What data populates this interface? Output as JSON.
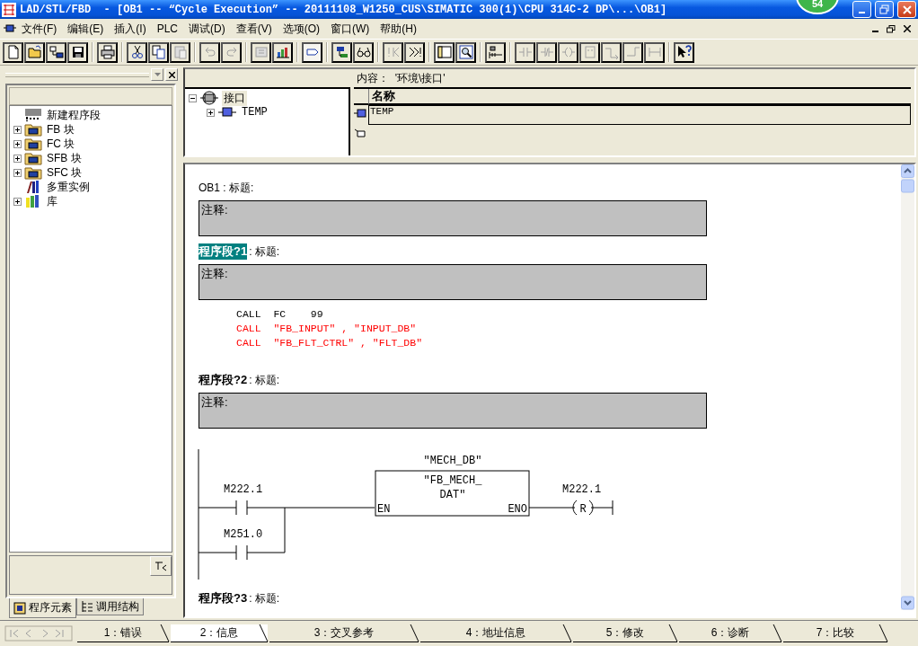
{
  "window": {
    "title": "LAD/STL/FBD  - [OB1 -- “Cycle Execution” -- 20111108_W1250_CUS\\SIMATIC 300(1)\\CPU 314C-2 DP\\...\\OB1]",
    "badge": "54"
  },
  "menu": [
    "文件(F)",
    "编辑(E)",
    "插入(I)",
    "PLC",
    "调试(D)",
    "查看(V)",
    "选项(O)",
    "窗口(W)",
    "帮助(H)"
  ],
  "toolbar": [
    {
      "kind": "new",
      "disabled": false,
      "pressed": false
    },
    {
      "kind": "open",
      "disabled": false,
      "pressed": false
    },
    {
      "kind": "network",
      "disabled": false,
      "pressed": false
    },
    {
      "kind": "save",
      "disabled": false,
      "pressed": false
    },
    {
      "kind": "separator"
    },
    {
      "kind": "print",
      "disabled": false,
      "pressed": false
    },
    {
      "kind": "separator"
    },
    {
      "kind": "cut",
      "disabled": false,
      "pressed": false
    },
    {
      "kind": "copy",
      "disabled": false,
      "pressed": false
    },
    {
      "kind": "paste",
      "disabled": true,
      "pressed": false
    },
    {
      "kind": "separator"
    },
    {
      "kind": "undo",
      "disabled": true,
      "pressed": false
    },
    {
      "kind": "redo",
      "disabled": true,
      "pressed": false
    },
    {
      "kind": "separator"
    },
    {
      "kind": "module",
      "disabled": true,
      "pressed": false
    },
    {
      "kind": "chart",
      "disabled": false,
      "pressed": false
    },
    {
      "kind": "separator"
    },
    {
      "kind": "frame",
      "disabled": false,
      "pressed": true
    },
    {
      "kind": "separator"
    },
    {
      "kind": "node",
      "disabled": false,
      "pressed": false
    },
    {
      "kind": "glasses",
      "disabled": false,
      "pressed": false
    },
    {
      "kind": "separator"
    },
    {
      "kind": "prev_error",
      "disabled": true,
      "pressed": false
    },
    {
      "kind": "next_error",
      "disabled": false,
      "pressed": false
    },
    {
      "kind": "separator"
    },
    {
      "kind": "window",
      "disabled": false,
      "pressed": true
    },
    {
      "kind": "zoom",
      "disabled": false,
      "pressed": false
    },
    {
      "kind": "separator"
    },
    {
      "kind": "ladder",
      "disabled": false,
      "pressed": false
    },
    {
      "kind": "separator"
    },
    {
      "kind": "contact",
      "disabled": true,
      "pressed": false
    },
    {
      "kind": "negated_contact",
      "disabled": true,
      "pressed": false
    },
    {
      "kind": "coil",
      "disabled": true,
      "pressed": false
    },
    {
      "kind": "box",
      "disabled": true,
      "pressed": false
    },
    {
      "kind": "branch_open",
      "disabled": true,
      "pressed": false
    },
    {
      "kind": "branch_close",
      "disabled": true,
      "pressed": false
    },
    {
      "kind": "connector",
      "disabled": true,
      "pressed": false
    },
    {
      "kind": "separator"
    },
    {
      "kind": "help",
      "disabled": false,
      "pressed": false
    }
  ],
  "sidebar": {
    "tree": [
      {
        "label": "新建程序段",
        "kind": "new_network"
      },
      {
        "label": "FB 块",
        "kind": "block",
        "expanded": false
      },
      {
        "label": "FC 块",
        "kind": "block",
        "expanded": false
      },
      {
        "label": "SFB 块",
        "kind": "block",
        "expanded": false
      },
      {
        "label": "SFC 块",
        "kind": "block",
        "expanded": false
      },
      {
        "label": "多重实例",
        "kind": "multi_instance"
      },
      {
        "label": "库",
        "kind": "library",
        "expanded": false
      }
    ],
    "tabs": [
      {
        "label": "程序元素",
        "selected": true,
        "kind": "elements"
      },
      {
        "label": "调用结构",
        "selected": false,
        "kind": "structure"
      }
    ]
  },
  "interface": {
    "tree": [
      {
        "label": "接口",
        "expanded": true,
        "selected": true,
        "kind": "interface",
        "children": [
          {
            "label": "TEMP",
            "expanded": false,
            "selected": false,
            "kind": "variable"
          }
        ]
      }
    ],
    "content_label": "内容：  '环境\\接口'",
    "columns": [
      "名称"
    ],
    "rows": [
      "TEMP"
    ]
  },
  "editor": {
    "block_title": "OB1 : 标题:",
    "block_comment": "注释:",
    "networks": [
      {
        "label": "程序段?1",
        "title": ": 标题:",
        "selected": true,
        "comment": "注释:",
        "kind": "stl",
        "lines": [
          {
            "text": "CALL  FC    99",
            "color": "#000000"
          },
          {
            "text": "CALL  \"FB_INPUT\" , \"INPUT_DB\"",
            "color": "#ff0000"
          },
          {
            "text": "CALL  \"FB_FLT_CTRL\" , \"FLT_DB\"",
            "color": "#ff0000"
          }
        ]
      },
      {
        "label": "程序段?2",
        "title": ": 标题:",
        "selected": false,
        "comment": "注释:",
        "kind": "ladder",
        "ladder": {
          "instance": "\"MECH_DB\"",
          "block": [
            "\"FB_MECH_",
            "DAT\""
          ],
          "en": "EN",
          "eno": "ENO",
          "contacts": [
            "M222.1",
            "M251.0"
          ],
          "coil_address": "M222.1",
          "coil_type": "R"
        }
      },
      {
        "label": "程序段?3",
        "title": ": 标题:",
        "selected": false,
        "kind": "empty"
      }
    ]
  },
  "output_tabs": [
    {
      "label": "1：错误",
      "selected": false
    },
    {
      "label": "2：信息",
      "selected": true
    },
    {
      "label": "3：交叉参考",
      "selected": false
    },
    {
      "label": "4：地址信息",
      "selected": false
    },
    {
      "label": "5：修改",
      "selected": false
    },
    {
      "label": "6：诊断",
      "selected": false
    },
    {
      "label": "7：比较",
      "selected": false
    }
  ]
}
